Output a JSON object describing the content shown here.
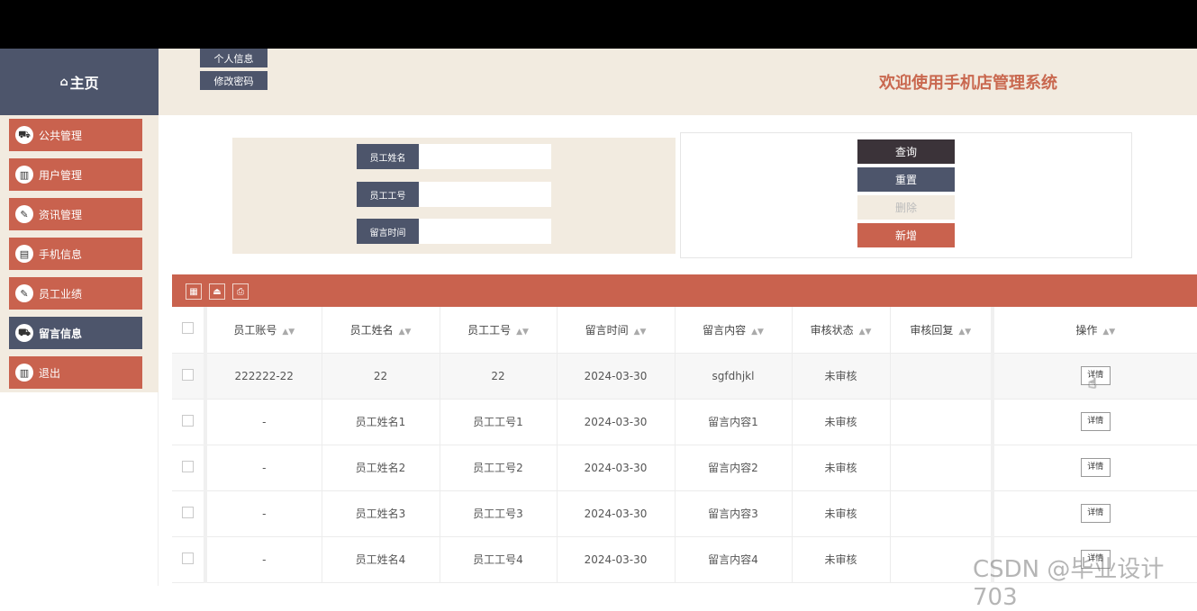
{
  "brand": {
    "icon": "home-icon",
    "title": "主页"
  },
  "header": {
    "buttons": [
      "个人信息",
      "修改密码"
    ],
    "welcome": "欢迎使用手机店管理系统"
  },
  "sidebar": {
    "items": [
      {
        "label": "公共管理",
        "icon": "car-icon"
      },
      {
        "label": "用户管理",
        "icon": "chart-icon"
      },
      {
        "label": "资讯管理",
        "icon": "edit-icon"
      },
      {
        "label": "手机信息",
        "icon": "clipboard-icon"
      },
      {
        "label": "员工业绩",
        "icon": "edit-icon"
      },
      {
        "label": "留言信息",
        "icon": "car-icon",
        "active": true
      },
      {
        "label": "退出",
        "icon": "chart-icon"
      }
    ]
  },
  "search": {
    "fields": [
      {
        "label": "员工姓名",
        "value": ""
      },
      {
        "label": "员工工号",
        "value": ""
      },
      {
        "label": "留言时间",
        "value": ""
      }
    ]
  },
  "actions": {
    "query": "查询",
    "reset": "重置",
    "delete": "删除",
    "add": "新增"
  },
  "toolbar": {
    "icons": [
      "filter-icon",
      "export-icon",
      "print-icon"
    ]
  },
  "table": {
    "headers": [
      "员工账号",
      "员工姓名",
      "员工工号",
      "留言时间",
      "留言内容",
      "审核状态",
      "审核回复",
      "操作"
    ],
    "detail_label": "详情",
    "rows": [
      [
        "222222-22",
        "22",
        "22",
        "2024-03-30",
        "sgfdhjkl",
        "未审核",
        ""
      ],
      [
        "-",
        "员工姓名1",
        "员工工号1",
        "2024-03-30",
        "留言内容1",
        "未审核",
        ""
      ],
      [
        "-",
        "员工姓名2",
        "员工工号2",
        "2024-03-30",
        "留言内容2",
        "未审核",
        ""
      ],
      [
        "-",
        "员工姓名3",
        "员工工号3",
        "2024-03-30",
        "留言内容3",
        "未审核",
        ""
      ],
      [
        "-",
        "员工姓名4",
        "员工工号4",
        "2024-03-30",
        "留言内容4",
        "未审核",
        ""
      ]
    ]
  },
  "watermark": "CSDN @毕业设计703",
  "colors": {
    "accent": "#c9624e",
    "dark": "#4d556b",
    "beige": "#f2ebe0",
    "title": "#c9684f"
  }
}
